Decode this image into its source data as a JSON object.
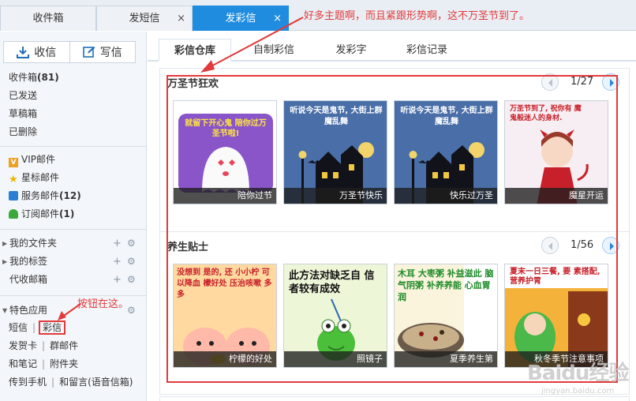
{
  "top_tabs": [
    {
      "label": "收件箱",
      "closable": false,
      "active": false
    },
    {
      "label": "发短信",
      "closable": true,
      "active": false
    },
    {
      "label": "发彩信",
      "closable": true,
      "active": true
    }
  ],
  "close_glyph": "×",
  "sidebar": {
    "receive_label": "收信",
    "compose_label": "写信",
    "mail_items": [
      {
        "label": "收件箱",
        "count": "(81)"
      },
      {
        "label": "已发送",
        "count": ""
      },
      {
        "label": "草稿箱",
        "count": ""
      },
      {
        "label": "已删除",
        "count": ""
      }
    ],
    "special_items": [
      {
        "label": "VIP邮件",
        "count": "",
        "icon": "vip-icon"
      },
      {
        "label": "星标邮件",
        "count": "",
        "icon": "star-icon"
      },
      {
        "label": "服务邮件",
        "count": "(12)",
        "icon": "service-icon"
      },
      {
        "label": "订阅邮件",
        "count": "(1)",
        "icon": "subscribe-icon"
      }
    ],
    "folders": [
      {
        "label": "我的文件夹"
      },
      {
        "label": "我的标签"
      },
      {
        "label": "代收邮箱"
      }
    ],
    "apps_label": "特色应用",
    "apps_rows": [
      [
        "短信",
        "彩信"
      ],
      [
        "发贺卡",
        "群邮件"
      ],
      [
        "和笔记",
        "附件夹"
      ],
      [
        "传到手机",
        "和留言(语音信箱)"
      ]
    ]
  },
  "sub_tabs": [
    "彩信仓库",
    "自制彩信",
    "发彩字",
    "彩信记录"
  ],
  "sections": [
    {
      "title": "万圣节狂欢",
      "page": "1/27",
      "cards": [
        {
          "caption": "陪你过节",
          "art": "ghost",
          "text": "就留下开心鬼 陪你过万圣节啦!"
        },
        {
          "caption": "万圣节快乐",
          "art": "house",
          "text": "听说今天是鬼节, 大街上群魔乱舞"
        },
        {
          "caption": "快乐过万圣",
          "art": "house",
          "text": "听说今天是鬼节, 大街上群魔乱舞"
        },
        {
          "caption": "魔星开运",
          "art": "devil",
          "text": "万圣节到了, 祝你有 魔鬼般迷人的身材."
        }
      ]
    },
    {
      "title": "养生贴士",
      "page": "1/56",
      "cards": [
        {
          "caption": "柠檬的好处",
          "art": "lemon",
          "text": "没想到 是的, 还 小小柠 可以降血 檬好处 压治咳嗽 多多"
        },
        {
          "caption": "照镜子",
          "art": "frog",
          "text": "此方法对缺乏自 信者较有成效"
        },
        {
          "caption": "夏季养生第",
          "art": "porridge",
          "text": "木耳 大枣粥 补益滋此 脑气阴粥 补养养能 心血胃润"
        },
        {
          "caption": "秋冬季节注意事项",
          "art": "green",
          "text": "夏末一日三餐, 要 素搭配,营养护胃"
        }
      ]
    }
  ],
  "annotations": {
    "top": "好多主题啊，而且紧跟形势啊，这不万圣节到了。",
    "side": "按钮在这。"
  },
  "watermark": {
    "main": "Baidu经验",
    "sub": "jingyan.baidu.com"
  },
  "colors": {
    "accent": "#1f8ce0",
    "annotation": "#e23a3a",
    "sidebar_bg": "#f3f6fa"
  }
}
